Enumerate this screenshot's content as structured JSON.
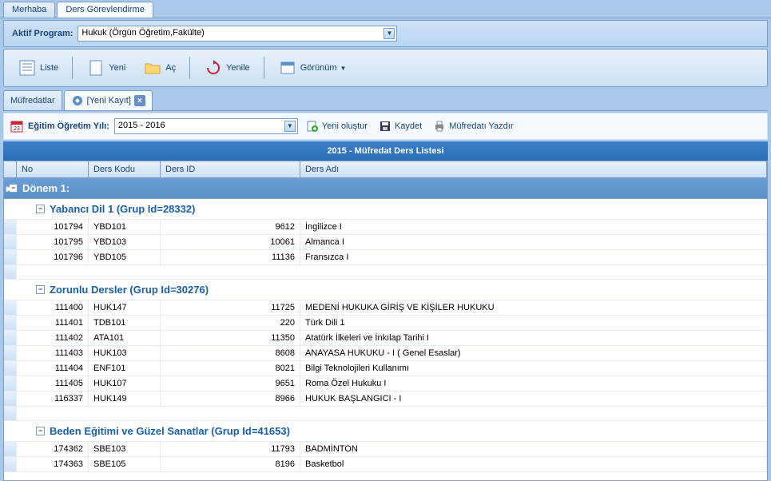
{
  "tabs": {
    "tab1": "Merhaba",
    "tab2": "Ders Görevlendirme"
  },
  "program": {
    "label": "Aktif Program:",
    "value": "Hukuk  (Örgün Öğretim,Fakülte)"
  },
  "toolbar": {
    "liste": "Liste",
    "yeni": "Yeni",
    "ac": "Aç",
    "yenile": "Yenile",
    "gorunum": "Görünüm"
  },
  "innerTabs": {
    "tab1": "Müfredatlar",
    "tab2": "[Yeni Kayıt]"
  },
  "year": {
    "label": "Eğitim Öğretim Yılı:",
    "value": "2015 - 2016",
    "yeniOlustur": "Yeni oluştur",
    "kaydet": "Kaydet",
    "mufredatiYazdir": "Müfredatı Yazdır"
  },
  "listTitle": "2015 - Müfredat Ders Listesi",
  "headers": {
    "no": "No",
    "dersKodu": "Ders Kodu",
    "dersId": "Ders ID",
    "dersAdi": "Ders Adı"
  },
  "donem": "Dönem 1:",
  "groups": [
    {
      "title": "Yabancı Dil 1 (Grup Id=28332)",
      "rows": [
        {
          "no": "101794",
          "kod": "YBD101",
          "id": "9612",
          "ad": "İngilizce I"
        },
        {
          "no": "101795",
          "kod": "YBD103",
          "id": "10061",
          "ad": "Almanca I"
        },
        {
          "no": "101796",
          "kod": "YBD105",
          "id": "11136",
          "ad": "Fransızca I"
        }
      ]
    },
    {
      "title": "Zorunlu Dersler (Grup Id=30276)",
      "rows": [
        {
          "no": "111400",
          "kod": "HUK147",
          "id": "11725",
          "ad": "MEDENİ HUKUKA GİRİŞ VE KİŞİLER HUKUKU"
        },
        {
          "no": "111401",
          "kod": "TDB101",
          "id": "220",
          "ad": "Türk Dili 1"
        },
        {
          "no": "111402",
          "kod": "ATA101",
          "id": "11350",
          "ad": "Atatürk İlkeleri ve İnkılap Tarihi I"
        },
        {
          "no": "111403",
          "kod": "HUK103",
          "id": "8608",
          "ad": "ANAYASA HUKUKU - I ( Genel Esaslar)"
        },
        {
          "no": "111404",
          "kod": "ENF101",
          "id": "8021",
          "ad": "Bilgi Teknolojileri Kullanımı"
        },
        {
          "no": "111405",
          "kod": "HUK107",
          "id": "9651",
          "ad": "Roma Özel Hukuku I"
        },
        {
          "no": "116337",
          "kod": "HUK149",
          "id": "8966",
          "ad": "HUKUK  BAŞLANGICI - I"
        }
      ]
    },
    {
      "title": "Beden Eğitimi ve Güzel Sanatlar (Grup Id=41653)",
      "rows": [
        {
          "no": "174362",
          "kod": "SBE103",
          "id": "11793",
          "ad": "BADMİNTON"
        },
        {
          "no": "174363",
          "kod": "SBE105",
          "id": "8196",
          "ad": "Basketbol"
        }
      ]
    }
  ]
}
